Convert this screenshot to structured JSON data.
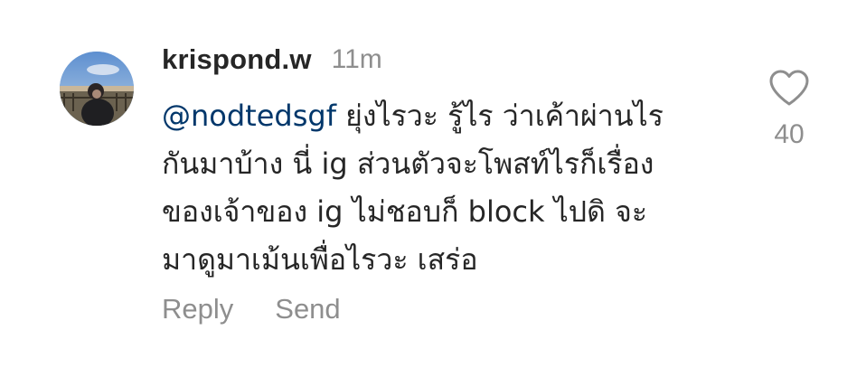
{
  "comment": {
    "username": "krispond.w",
    "timestamp": "11m",
    "mention": "@nodtedsgf",
    "lines": [
      "ยุ่งไรวะ รู้ไร ว่าเค้าผ่านไร",
      "กันมาบ้าง นี่ ig ส่วนตัวจะโพสท์ไรก็เรื่อง",
      "ของเจ้าของ ig ไม่ชอบก็ block ไปดิ จะ",
      "มาดูมาเม้นเพื่อไรวะ เสร่อ"
    ],
    "actions": {
      "reply": "Reply",
      "send": "Send"
    },
    "like": {
      "icon": "heart-outline-icon",
      "count": "40"
    }
  },
  "colors": {
    "text": "#262626",
    "secondary": "#8e8e8e",
    "mention": "#00376b"
  }
}
